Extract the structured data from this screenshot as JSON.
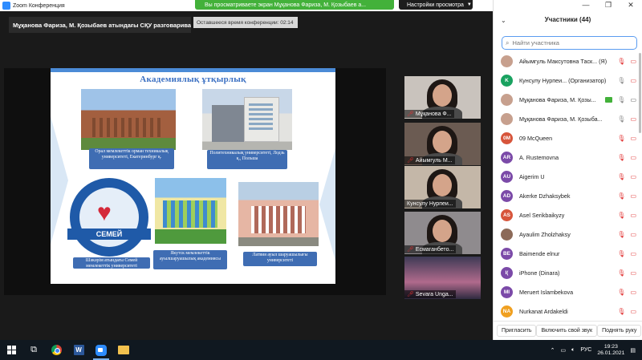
{
  "window": {
    "title": "Zoom Конференция"
  },
  "share_banner": {
    "text": "Вы просматриваете экран Мұқанова Фариза, М. Қозыбаев а..."
  },
  "view_options": {
    "label": "Настройки просмотра",
    "caret": "▼"
  },
  "speaker": {
    "text": "Мұқанова Фариза, М. Қозыбаев атындағы СҚУ разговаривает..."
  },
  "timer": {
    "text": "Оставшееся время конференции: 02:14"
  },
  "slide": {
    "title": "Академиялық ұтқырлық",
    "captions": [
      "Орал мемлекеттік орман техникалық университеті, Екатеринбург қ.",
      "Политехникалық университеті, Лодзь қ., Польша",
      "Шәкәрім атындағы Семей мемлекеттік университеті",
      "Якутск мемлекеттік ауылшаруашылық академиясы",
      "Латвия ауыл шаруашылығы университеті"
    ],
    "logo_text": "СЕМЕЙ"
  },
  "thumbnails": [
    {
      "name": "Мұқанова Ф..."
    },
    {
      "name": "Айымгуль М..."
    },
    {
      "name": "Кунсулу Нурпеи..."
    },
    {
      "name": "Есмаганбето..."
    },
    {
      "name": "Sevara Unga..."
    }
  ],
  "panel": {
    "title": "Участники (44)",
    "search_placeholder": "Найти участника",
    "window_controls": [
      "—",
      "❐",
      "✕"
    ],
    "participants": [
      {
        "name": "Айымгуль Максутовна Таск...  (Я)",
        "initials": "",
        "color": "#c7a08e",
        "mic": "off",
        "cam": "off"
      },
      {
        "name": "Кунсулу Нурпеи...  (Организатор)",
        "initials": "K",
        "color": "#1aa260",
        "mic": "on",
        "cam": "off"
      },
      {
        "name": "Мұқанова Фариза, М. Қозы...",
        "initials": "",
        "color": "#c7a08e",
        "mic": "on",
        "cam": "on",
        "sharing": true
      },
      {
        "name": "Мұқанова Фариза, М. Қозыба...",
        "initials": "",
        "color": "#c7a08e",
        "mic": "on",
        "cam": "off"
      },
      {
        "name": "09 McQueen",
        "initials": "0M",
        "color": "#d7553b",
        "mic": "off",
        "cam": "off"
      },
      {
        "name": "A. Rustemovna",
        "initials": "AR",
        "color": "#7b4aa8",
        "mic": "off",
        "cam": "off"
      },
      {
        "name": "Aigerim U",
        "initials": "AU",
        "color": "#7b4aa8",
        "mic": "off",
        "cam": "off"
      },
      {
        "name": "Akerke Dzhaksybek",
        "initials": "AD",
        "color": "#7b4aa8",
        "mic": "off",
        "cam": "off"
      },
      {
        "name": "Asel Serikbaikyzy",
        "initials": "AS",
        "color": "#d7553b",
        "mic": "off",
        "cam": "off"
      },
      {
        "name": "Ayaulim Zholzhaksy",
        "initials": "",
        "color": "#8c6a58",
        "mic": "off",
        "cam": "off"
      },
      {
        "name": "Baimende elnur",
        "initials": "BE",
        "color": "#7b4aa8",
        "mic": "off",
        "cam": "off"
      },
      {
        "name": "iPhone (Dinara)",
        "initials": "I(",
        "color": "#7b4aa8",
        "mic": "off",
        "cam": "off"
      },
      {
        "name": "Meruert Islambekova",
        "initials": "MI",
        "color": "#7b4aa8",
        "mic": "off",
        "cam": "off"
      },
      {
        "name": "Nurkanat Ardakeldi",
        "initials": "NA",
        "color": "#f0a020",
        "mic": "off",
        "cam": "off"
      }
    ],
    "buttons": {
      "invite": "Пригласить",
      "unmute": "Включить свой звук",
      "raise": "Поднять руку"
    }
  },
  "taskbar": {
    "lang": "РУС",
    "time": "19:23",
    "date": "26.01.2021"
  }
}
